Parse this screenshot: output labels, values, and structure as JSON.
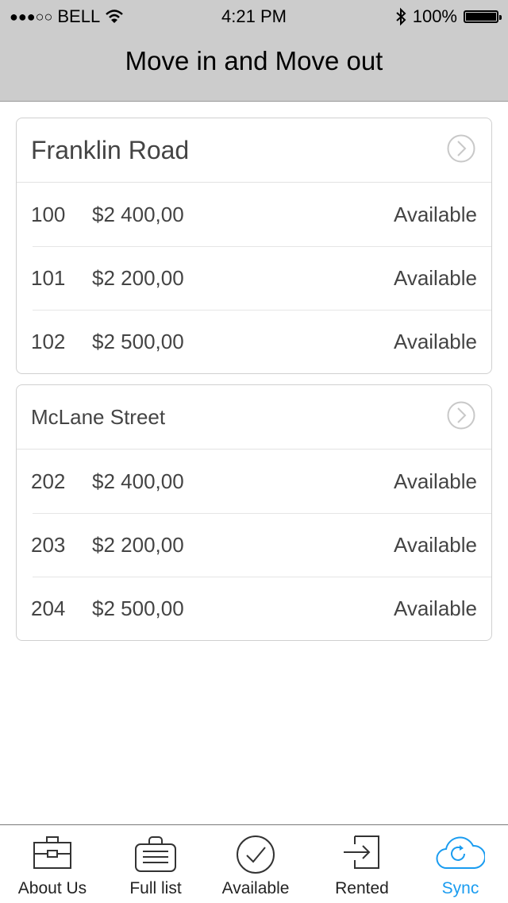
{
  "status_bar": {
    "signal": "●●●○○",
    "carrier": "BELL",
    "time": "4:21 PM",
    "battery": "100%"
  },
  "header": {
    "title": "Move in and Move out"
  },
  "properties": [
    {
      "name": "Franklin Road",
      "units": [
        {
          "number": "100",
          "price": "$2 400,00",
          "status": "Available"
        },
        {
          "number": "101",
          "price": "$2 200,00",
          "status": "Available"
        },
        {
          "number": "102",
          "price": "$2 500,00",
          "status": "Available"
        }
      ]
    },
    {
      "name": "McLane Street",
      "units": [
        {
          "number": "202",
          "price": "$2 400,00",
          "status": "Available"
        },
        {
          "number": "203",
          "price": "$2 200,00",
          "status": "Available"
        },
        {
          "number": "204",
          "price": "$2 500,00",
          "status": "Available"
        }
      ]
    }
  ],
  "tabbar": {
    "active_color": "#1a9cf0",
    "tabs": [
      {
        "label": "About Us",
        "icon": "briefcase-icon"
      },
      {
        "label": "Full list",
        "icon": "list-bag-icon"
      },
      {
        "label": "Available",
        "icon": "check-circle-icon"
      },
      {
        "label": "Rented",
        "icon": "sign-in-icon"
      },
      {
        "label": "Sync",
        "icon": "cloud-sync-icon",
        "active": true
      }
    ]
  }
}
